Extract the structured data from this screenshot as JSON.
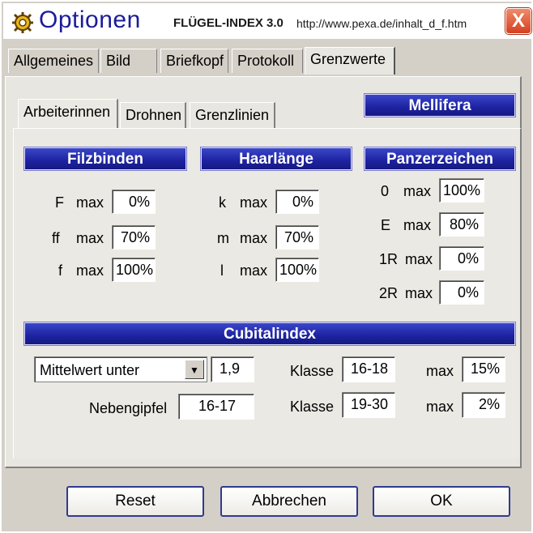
{
  "window": {
    "title": "Optionen",
    "subtitle": "FLÜGEL-INDEX 3.0",
    "url": "http://www.pexa.de/inhalt_d_f.htm",
    "close_label": "X",
    "icon": "gear-icon"
  },
  "tabs": [
    "Allgemeines",
    "Bild",
    "Briefkopf",
    "Protokoll",
    "Grenzwerte"
  ],
  "active_tab": "Grenzwerte",
  "subtabs": [
    "Arbeiterinnen",
    "Drohnen",
    "Grenzlinien"
  ],
  "active_subtab": "Arbeiterinnen",
  "mellifera_label": "Mellifera",
  "filzbinden": {
    "header": "Filzbinden",
    "rows": [
      {
        "name": "F",
        "max": "max",
        "value": "0%"
      },
      {
        "name": "ff",
        "max": "max",
        "value": "70%"
      },
      {
        "name": "f",
        "max": "max",
        "value": "100%"
      }
    ]
  },
  "haarlaenge": {
    "header": "Haarlänge",
    "rows": [
      {
        "name": "k",
        "max": "max",
        "value": "0%"
      },
      {
        "name": "m",
        "max": "max",
        "value": "70%"
      },
      {
        "name": "l",
        "max": "max",
        "value": "100%"
      }
    ]
  },
  "panzerzeichen": {
    "header": "Panzerzeichen",
    "rows": [
      {
        "name": "0",
        "max": "max",
        "value": "100%"
      },
      {
        "name": "E",
        "max": "max",
        "value": "80%"
      },
      {
        "name": "1R",
        "max": "max",
        "value": "0%"
      },
      {
        "name": "2R",
        "max": "max",
        "value": "0%"
      }
    ]
  },
  "cubitalindex": {
    "header": "Cubitalindex",
    "mode_select": "Mittelwert unter",
    "mode_value": "1,9",
    "nebengipfel_label": "Nebengipfel",
    "nebengipfel_value": "16-17",
    "klasse_rows": [
      {
        "label": "Klasse",
        "range": "16-18",
        "max": "max",
        "value": "15%"
      },
      {
        "label": "Klasse",
        "range": "19-30",
        "max": "max",
        "value": "2%"
      }
    ]
  },
  "buttons": {
    "reset": "Reset",
    "cancel": "Abbrechen",
    "ok": "OK"
  },
  "colors": {
    "header_bar": "#1d22a0",
    "close_button": "#d54020",
    "title_text": "#1c1c9a"
  }
}
